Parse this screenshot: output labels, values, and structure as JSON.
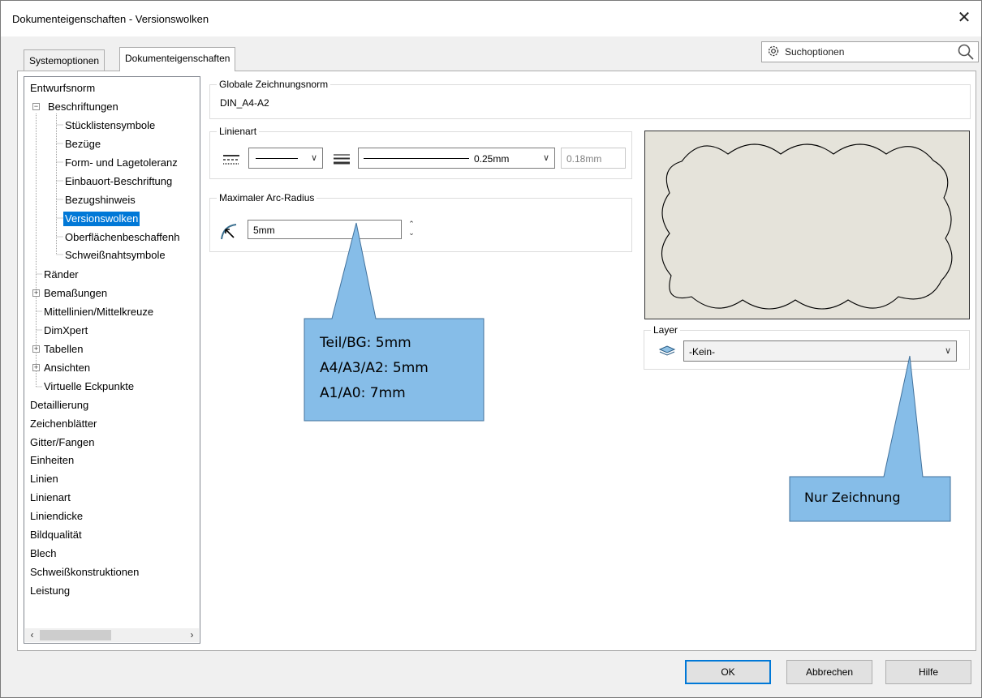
{
  "window": {
    "title": "Dokumenteigenschaften - Versionswolken"
  },
  "tabs": [
    {
      "label": "Systemoptionen",
      "active": false
    },
    {
      "label": "Dokumenteigenschaften",
      "active": true
    }
  ],
  "search": {
    "label": "Suchoptionen"
  },
  "tree": {
    "items": [
      {
        "label": "Entwurfsnorm"
      },
      {
        "label": "Beschriftungen",
        "expander": "−"
      },
      {
        "label": "Stücklistensymbole"
      },
      {
        "label": "Bezüge"
      },
      {
        "label": "Form- und Lagetoleranz"
      },
      {
        "label": "Einbauort-Beschriftung"
      },
      {
        "label": "Bezugshinweis"
      },
      {
        "label": "Versionswolken",
        "selected": true
      },
      {
        "label": "Oberflächenbeschaffenh"
      },
      {
        "label": "Schweißnahtsymbole"
      },
      {
        "label": "Ränder"
      },
      {
        "label": "Bemaßungen",
        "expander": "+"
      },
      {
        "label": "Mittellinien/Mittelkreuze"
      },
      {
        "label": "DimXpert"
      },
      {
        "label": "Tabellen",
        "expander": "+"
      },
      {
        "label": "Ansichten",
        "expander": "+"
      },
      {
        "label": "Virtuelle Eckpunkte"
      },
      {
        "label": "Detaillierung"
      },
      {
        "label": "Zeichenblätter"
      },
      {
        "label": "Gitter/Fangen"
      },
      {
        "label": "Einheiten"
      },
      {
        "label": "Linien"
      },
      {
        "label": "Linienart"
      },
      {
        "label": "Liniendicke"
      },
      {
        "label": "Bildqualität"
      },
      {
        "label": "Blech"
      },
      {
        "label": "Schweißkonstruktionen"
      },
      {
        "label": "Leistung"
      }
    ]
  },
  "global_standard": {
    "title": "Globale Zeichnungsnorm",
    "value": "DIN_A4-A2"
  },
  "line_style": {
    "title": "Linienart",
    "thickness_value": "0.25mm",
    "custom_value": "0.18mm"
  },
  "arc_radius": {
    "title": "Maximaler Arc-Radius",
    "value": "5mm"
  },
  "layer": {
    "title": "Layer",
    "value": "-Kein-"
  },
  "callouts": {
    "left": {
      "lines": [
        "Teil/BG: 5mm",
        "A4/A3/A2: 5mm",
        "A1/A0: 7mm"
      ],
      "fill": "#86bde8",
      "stroke": "#41719c"
    },
    "right": {
      "text": "Nur Zeichnung",
      "fill": "#86bde8",
      "stroke": "#41719c"
    }
  },
  "buttons": {
    "ok": "OK",
    "cancel": "Abbrechen",
    "help": "Hilfe"
  },
  "colors": {
    "selection": "#0078d7",
    "preview_bg": "#e5e3da"
  }
}
